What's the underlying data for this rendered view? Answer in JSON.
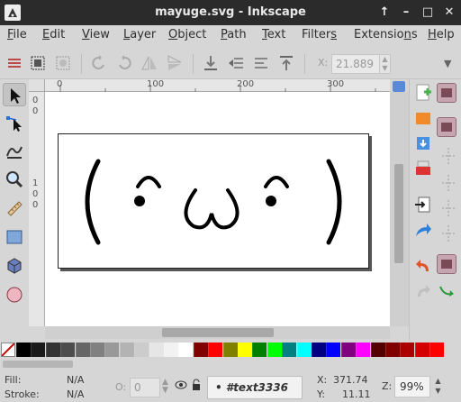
{
  "window": {
    "title": "mayuge.svg - Inkscape",
    "controls": [
      "↑",
      "–",
      "□",
      "✕"
    ]
  },
  "menu": [
    {
      "label": "File",
      "mnemonic": "F",
      "rest": "ile"
    },
    {
      "label": "Edit",
      "mnemonic": "E",
      "rest": "dit"
    },
    {
      "label": "View",
      "mnemonic": "V",
      "rest": "iew"
    },
    {
      "label": "Layer",
      "mnemonic": "L",
      "rest": "ayer"
    },
    {
      "label": "Object",
      "mnemonic": "O",
      "rest": "bject"
    },
    {
      "label": "Path",
      "mnemonic": "P",
      "rest": "ath"
    },
    {
      "label": "Text",
      "mnemonic": "T",
      "rest": "ext"
    },
    {
      "label": "Filters",
      "mnemonic": "s",
      "rest": "Filter"
    },
    {
      "label": "Extensions",
      "mnemonic": "n",
      "rest": "Extensio"
    },
    {
      "label": "Help",
      "mnemonic": "H",
      "rest": "elp"
    }
  ],
  "toolbar": {
    "x_label": "X:",
    "x_value": "21.889",
    "overflow": "▼"
  },
  "tools": [
    "selector-tool",
    "node-tool",
    "tweak-tool",
    "zoom-tool",
    "measure-tool",
    "rectangle-tool",
    "3d-box-tool",
    "ellipse-tool"
  ],
  "rulers": {
    "h_ticks": [
      "0",
      "100",
      "200",
      "300"
    ],
    "v_ticks": [
      "0",
      "0",
      "1",
      "0",
      "0"
    ]
  },
  "canvas": {
    "text": "( ͡° ω ͡° )"
  },
  "palette": {
    "colors": [
      "#000000",
      "#1a1a1a",
      "#333333",
      "#4d4d4d",
      "#666666",
      "#808080",
      "#999999",
      "#b3b3b3",
      "#cccccc",
      "#e6e6e6",
      "#f2f2f2",
      "#ffffff",
      "#800000",
      "#ff0000",
      "#808000",
      "#ffff00",
      "#008000",
      "#00ff00",
      "#008080",
      "#00ffff",
      "#000080",
      "#0000ff",
      "#800080",
      "#ff00ff",
      "#550000",
      "#800000",
      "#aa0000",
      "#d40000",
      "#ff0000"
    ]
  },
  "status": {
    "fill_label": "Fill:",
    "fill_value": "N/A",
    "stroke_label": "Stroke:",
    "stroke_value": "N/A",
    "opacity_label": "O:",
    "opacity_value": "0",
    "layer_name": "• #text3336",
    "x_label": "X:",
    "x_value": "371.74",
    "y_label": "Y:",
    "y_value": "11.11",
    "zoom_label": "Z:",
    "zoom_value": "99%"
  }
}
